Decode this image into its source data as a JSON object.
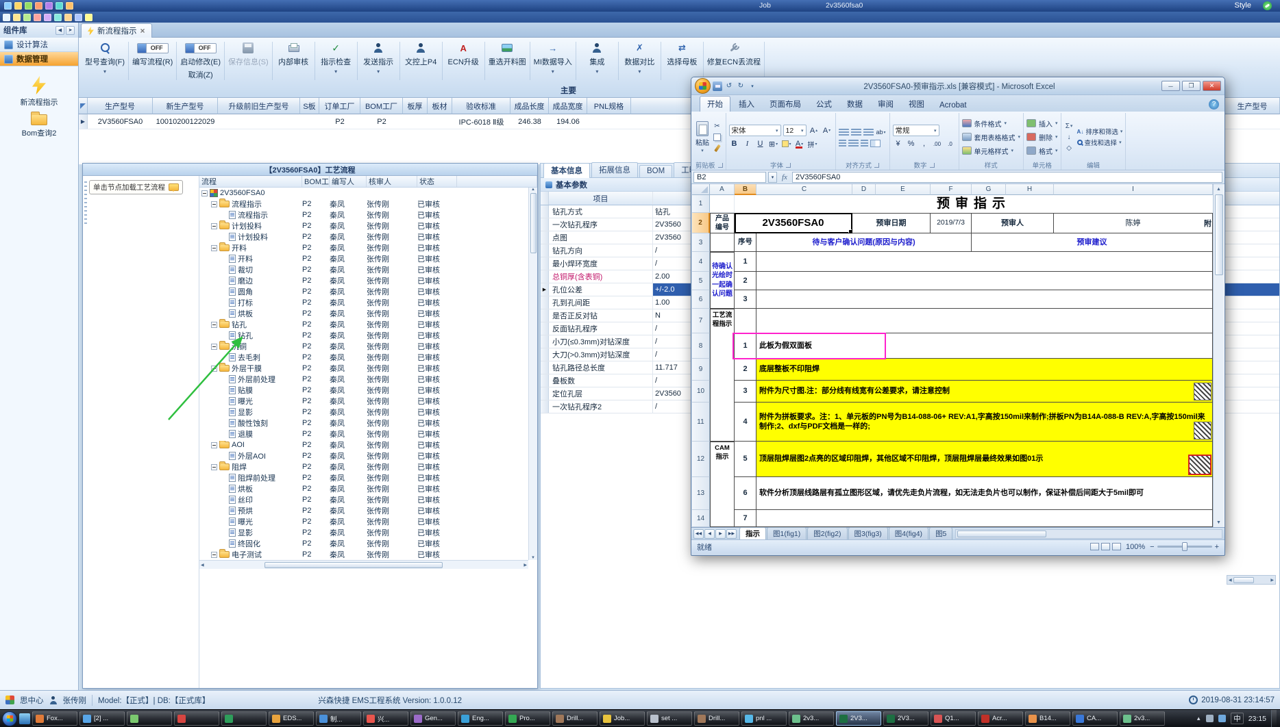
{
  "window": {
    "style_menu": "Style",
    "background_titles": [
      "Job",
      "2v3560fsa0"
    ],
    "bar1_icons": [
      {
        "name": "app-icon-1",
        "color": "#8fd0ff"
      },
      {
        "name": "app-icon-2",
        "color": "#ffd666"
      },
      {
        "name": "app-icon-3",
        "color": "#95de64"
      },
      {
        "name": "app-icon-4",
        "color": "#ff9c6e"
      },
      {
        "name": "app-icon-5",
        "color": "#b37feb"
      },
      {
        "name": "app-icon-6",
        "color": "#5cdbd3"
      },
      {
        "name": "app-icon-7",
        "color": "#ffc069"
      }
    ],
    "bar2_icons": [
      {
        "name": "tool-icon-1",
        "color": "#e8f4ff"
      },
      {
        "name": "tool-icon-2",
        "color": "#ffe58f"
      },
      {
        "name": "tool-icon-3",
        "color": "#b7eb8f"
      },
      {
        "name": "tool-icon-4",
        "color": "#ffa39e"
      },
      {
        "name": "tool-icon-5",
        "color": "#d3adf7"
      },
      {
        "name": "tool-icon-6",
        "color": "#87e8de"
      },
      {
        "name": "tool-icon-7",
        "color": "#ffd591"
      },
      {
        "name": "tool-icon-8",
        "color": "#adc6ff"
      },
      {
        "name": "tool-icon-9",
        "color": "#fffb8f"
      }
    ]
  },
  "component_panel": {
    "title": "组件库"
  },
  "doc_tab": {
    "label": "新流程指示"
  },
  "sidebar": {
    "sections": [
      {
        "label": "设计算法",
        "active": false
      },
      {
        "label": "数据管理",
        "active": true
      }
    ],
    "shortcuts": [
      {
        "label": "新流程指示",
        "icon": "lightning-icon"
      },
      {
        "label": "Bom查询2",
        "icon": "folder-icon"
      }
    ]
  },
  "toolbar": {
    "section_fragment": "主要",
    "buttons": [
      {
        "label": "型号查询(F)",
        "icon": "search-icon",
        "dropdown": true
      },
      {
        "label": "编写流程(R)",
        "icon": "toggle-icon",
        "toggle": "OFF"
      },
      {
        "label": "启动修改(E)",
        "label2": "取消(Z)",
        "icon": "toggle-icon",
        "toggle": "OFF"
      },
      {
        "label": "保存信息(S)",
        "icon": "save-icon",
        "disabled": true
      },
      {
        "label": "内部审核",
        "icon": "printer-icon"
      },
      {
        "label": "指示检查",
        "icon": "check-icon",
        "dropdown": true
      },
      {
        "label": "发送指示",
        "icon": "send-icon",
        "dropdown": true
      },
      {
        "label": "文控上P4",
        "icon": "person-icon"
      },
      {
        "label": "ECN升级",
        "icon": "ecn-icon"
      },
      {
        "label": "重选开料图",
        "icon": "image-icon"
      },
      {
        "label": "MI数据导入",
        "icon": "import-icon",
        "dropdown": true
      },
      {
        "label": "集成",
        "icon": "person-icon",
        "dropdown": true
      },
      {
        "label": "数据对比",
        "icon": "compare-icon",
        "dropdown": true
      },
      {
        "label": "选择母板",
        "icon": "swap-icon"
      },
      {
        "label": "修复ECN丢流程",
        "icon": "wrench-icon"
      }
    ]
  },
  "model_grid": {
    "columns": [
      "生产型号",
      "新生产型号",
      "升级前旧生产型号",
      "S板",
      "订单工厂",
      "BOM工厂",
      "板厚",
      "板材",
      "验收标准",
      "成品长度",
      "成品宽度",
      "PNL规格"
    ],
    "far_right_column": "生产型号",
    "row": [
      "2V3560FSA0",
      "10010200122029",
      "",
      "",
      "P2",
      "P2",
      "",
      "",
      "IPC-6018 Ⅱ级",
      "246.38",
      "194.06",
      ""
    ]
  },
  "process_window": {
    "title": "【2V3560FSA0】工艺流程",
    "tooltip": "单击节点加载工艺流程",
    "columns": [
      "流程",
      "BOM工厂",
      "编写人",
      "核审人",
      "状态"
    ],
    "defaults": {
      "factory": "P2",
      "writer": "秦凤",
      "auditor": "张传刚",
      "status": "已审核"
    },
    "tree": [
      {
        "level": 0,
        "type": "root",
        "label": "2V3560FSA0"
      },
      {
        "level": 1,
        "type": "folder",
        "label": "流程指示"
      },
      {
        "level": 2,
        "type": "leaf",
        "label": "流程指示"
      },
      {
        "level": 1,
        "type": "folder",
        "label": "计划投料"
      },
      {
        "level": 2,
        "type": "leaf",
        "label": "计划投料"
      },
      {
        "level": 1,
        "type": "folder",
        "label": "开料"
      },
      {
        "level": 2,
        "type": "leaf",
        "label": "开料"
      },
      {
        "level": 2,
        "type": "leaf",
        "label": "裁切"
      },
      {
        "level": 2,
        "type": "leaf",
        "label": "磨边"
      },
      {
        "level": 2,
        "type": "leaf",
        "label": "圆角"
      },
      {
        "level": 2,
        "type": "leaf",
        "label": "打标"
      },
      {
        "level": 2,
        "type": "leaf",
        "label": "烘板"
      },
      {
        "level": 1,
        "type": "folder",
        "label": "钻孔"
      },
      {
        "level": 2,
        "type": "leaf",
        "label": "钻孔"
      },
      {
        "level": 1,
        "type": "folder",
        "label": "沉铜"
      },
      {
        "level": 2,
        "type": "leaf",
        "label": "去毛刺"
      },
      {
        "level": 1,
        "type": "folder",
        "label": "外层干膜"
      },
      {
        "level": 2,
        "type": "leaf",
        "label": "外层前处理"
      },
      {
        "level": 2,
        "type": "leaf",
        "label": "贴膜"
      },
      {
        "level": 2,
        "type": "leaf",
        "label": "曝光"
      },
      {
        "level": 2,
        "type": "leaf",
        "label": "显影"
      },
      {
        "level": 2,
        "type": "leaf",
        "label": "酸性蚀刻"
      },
      {
        "level": 2,
        "type": "leaf",
        "label": "退膜"
      },
      {
        "level": 1,
        "type": "folder",
        "label": "AOI"
      },
      {
        "level": 2,
        "type": "leaf",
        "label": "外层AOI"
      },
      {
        "level": 1,
        "type": "folder",
        "label": "阻焊"
      },
      {
        "level": 2,
        "type": "leaf",
        "label": "阻焊前处理"
      },
      {
        "level": 2,
        "type": "leaf",
        "label": "烘板"
      },
      {
        "level": 2,
        "type": "leaf",
        "label": "丝印"
      },
      {
        "level": 2,
        "type": "leaf",
        "label": "预烘"
      },
      {
        "level": 2,
        "type": "leaf",
        "label": "曝光"
      },
      {
        "level": 2,
        "type": "leaf",
        "label": "显影"
      },
      {
        "level": 2,
        "type": "leaf",
        "label": "终固化"
      },
      {
        "level": 1,
        "type": "folder",
        "label": "电子测试"
      }
    ]
  },
  "params_panel": {
    "tabs": [
      "基本信息",
      "拓展信息",
      "BOM",
      "工时"
    ],
    "active_tab": "基本信息",
    "section_title": "基本参数",
    "table_header": "项目",
    "rows": [
      {
        "label": "钻孔方式",
        "value": "钻孔"
      },
      {
        "label": "一次钻孔程序",
        "value": "2V3560"
      },
      {
        "label": "点图",
        "value": "2V3560"
      },
      {
        "label": "钻孔方向",
        "value": "/"
      },
      {
        "label": "最小焊环宽度",
        "value": "/"
      },
      {
        "label": "总铜厚(含表铜)",
        "value": "2.00",
        "label_color": "#c2186b"
      },
      {
        "label": "孔位公差",
        "value": "+/-2.0",
        "selected": true
      },
      {
        "label": "孔到孔间距",
        "value": "1.00"
      },
      {
        "label": "是否正反对钻",
        "value": "N"
      },
      {
        "label": "反面钻孔程序",
        "value": "/"
      },
      {
        "label": "小刀(≤0.3mm)对钻深度",
        "value": "/"
      },
      {
        "label": "大刀(>0.3mm)对钻深度",
        "value": "/"
      },
      {
        "label": "钻孔路径总长度",
        "value": "11.717"
      },
      {
        "label": "叠板数",
        "value": "/"
      },
      {
        "label": "定位孔层",
        "value": "2V3560"
      },
      {
        "label": "一次钻孔程序2",
        "value": "/"
      }
    ]
  },
  "excel": {
    "title": "2V3560FSA0-预审指示.xls [兼容模式] - Microsoft Excel",
    "ribbon": {
      "tabs": [
        "开始",
        "插入",
        "页面布局",
        "公式",
        "数据",
        "审阅",
        "视图",
        "Acrobat"
      ],
      "active_tab": "开始",
      "clipboard_group": {
        "label": "剪贴板",
        "paste": "粘贴"
      },
      "font_group": {
        "label": "字体",
        "font_name": "宋体",
        "font_size": "12"
      },
      "align_group": {
        "label": "对齐方式"
      },
      "number_group": {
        "label": "数字",
        "format": "常规"
      },
      "styles_group": {
        "label": "样式",
        "buttons": [
          "条件格式",
          "套用表格格式",
          "单元格样式"
        ]
      },
      "cells_group": {
        "label": "单元格",
        "buttons": [
          "插入",
          "删除",
          "格式"
        ]
      },
      "edit_group": {
        "label": "编辑",
        "buttons": [
          "排序和筛选",
          "查找和选择"
        ]
      }
    },
    "name_box": "B2",
    "fx_label": "fx",
    "formula": "2V3560FSA0",
    "columns": [
      "A",
      "B",
      "C",
      "D",
      "E",
      "F",
      "G",
      "H",
      "I"
    ],
    "selected_column": "B",
    "selected_row": "2",
    "row_numbers": [
      "1",
      "2",
      "3",
      "4",
      "5",
      "6",
      "7",
      "8",
      "9",
      "10",
      "11",
      "12",
      "13",
      "14"
    ],
    "sheet": {
      "title": "预审指示",
      "product_label": "产品编号",
      "product_value": "2V3560FSA0",
      "date_label": "预审日期",
      "date_value": "2019/7/3",
      "reviewer_label": "预审人",
      "reviewer_value": "陈婷",
      "edge_fragment": "附",
      "seq_header": "序号",
      "confirm_header": "待与客户确认问题(原因与内容)",
      "advice_header": "预审建议",
      "confirm_group_label": "待确认光绘时一起确认问题",
      "confirm_rows": [
        "1",
        "2",
        "3"
      ],
      "process_group_label": "工艺流程指示",
      "cam_group_label": "CAM指示",
      "instructions": [
        {
          "no": "1",
          "text": "此板为假双面板",
          "style": "box"
        },
        {
          "no": "2",
          "text": "底层整板不印阻焊",
          "style": "yellow"
        },
        {
          "no": "3",
          "text": "附件为尺寸图.注：部分线有线宽有公差要求，请注意控制",
          "style": "yellow",
          "hatch": "plain"
        },
        {
          "no": "4",
          "text": "附件为拼板要求。注：1、单元板的PN号为B14-088-06+ REV:A1,字高按150mil来制作;拼板PN为B14A-088-B REV:A,字高按150mil来制作;2、dxf与PDF文档是一样的;",
          "style": "yellow",
          "hatch": "plain"
        },
        {
          "no": "5",
          "text": "顶层阻焊层图2点亮的区域印阻焊，其他区域不印阻焊，顶层阻焊层最终效果如图01示",
          "style": "yellow",
          "hatch": "red"
        },
        {
          "no": "6",
          "text": "软件分析顶层线路层有孤立图形区域，请优先走负片流程，如无法走负片也可以制作，保证补偿后间距大于5mil即可",
          "style": "plain"
        },
        {
          "no": "7",
          "text": "",
          "style": "plain"
        }
      ]
    },
    "sheet_tabs": [
      "指示",
      "图1(fig1)",
      "图2(fig2)",
      "图3(fig3)",
      "图4(fig4)",
      "图5"
    ],
    "active_sheet": "指示",
    "status": {
      "ready": "就绪",
      "zoom": "100%"
    }
  },
  "statusbar": {
    "brand": "思中心",
    "user": "张传刚",
    "mode": "Model:【正式】| DB:【正式库】",
    "app_info": "兴森快捷 EMS工程系统 Version: 1.0.0.12",
    "datetime": "2019-08-31 23:14:57"
  },
  "taskbar": {
    "ime": "中",
    "time": "23:15",
    "items": [
      {
        "label": "Fox...",
        "color": "#e07b39"
      },
      {
        "label": "[2] ...",
        "color": "#58a6e8"
      },
      {
        "label": "",
        "color": "#7bc96f"
      },
      {
        "label": "",
        "color": "#d64541"
      },
      {
        "label": "",
        "color": "#2e9e5b"
      },
      {
        "label": "EDS...",
        "color": "#e8a33d"
      },
      {
        "label": "制...",
        "color": "#4a90d9"
      },
      {
        "label": "兴...",
        "color": "#e8554d"
      },
      {
        "label": "Gen...",
        "color": "#9b6bc9"
      },
      {
        "label": "Eng...",
        "color": "#3aa0d8"
      },
      {
        "label": "Pro...",
        "color": "#34a853"
      },
      {
        "label": "Drill...",
        "color": "#a0785a"
      },
      {
        "label": "Job...",
        "color": "#e8c33d"
      },
      {
        "label": "set ...",
        "color": "#b8c0cc"
      },
      {
        "label": "Drill...",
        "color": "#a0785a"
      },
      {
        "label": "pnl ...",
        "color": "#56b8e8"
      },
      {
        "label": "2v3...",
        "color": "#6cc08c"
      },
      {
        "label": "2V3...",
        "color": "#1d6f42",
        "active": true
      },
      {
        "label": "2V3...",
        "color": "#1d6f42"
      },
      {
        "label": "Q1...",
        "color": "#d85454"
      },
      {
        "label": "Acr...",
        "color": "#c03028"
      },
      {
        "label": "B14...",
        "color": "#e8924a"
      },
      {
        "label": "CA...",
        "color": "#3a78d8"
      },
      {
        "label": "2v3...",
        "color": "#6cc08c"
      }
    ]
  }
}
